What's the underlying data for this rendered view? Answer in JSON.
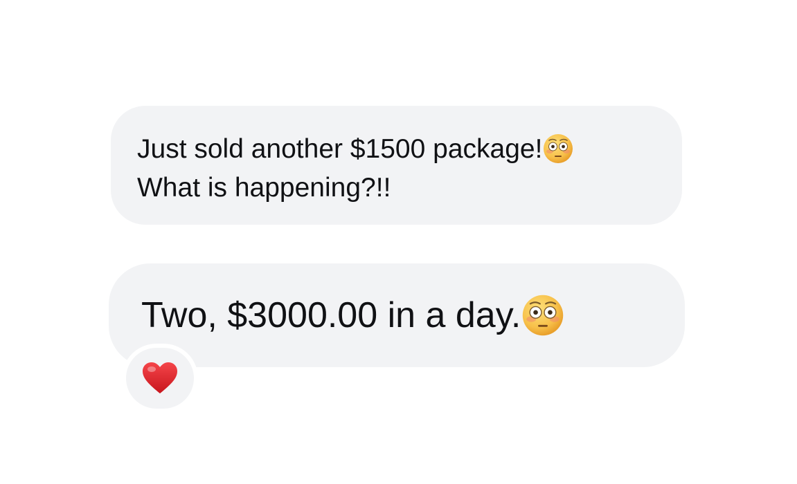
{
  "messages": [
    {
      "lines": [
        "Just sold another $1500 package!",
        "What is happening?!!"
      ],
      "emoji": "flushed-face-icon"
    },
    {
      "text": "Two, $3000.00 in a day.",
      "emoji": "flushed-face-icon"
    }
  ],
  "reaction": {
    "emoji": "red-heart-icon"
  },
  "colors": {
    "bubble_background": "#f2f3f5",
    "text": "#101114",
    "background": "#ffffff",
    "heart": "#e0242b",
    "emoji_face": "#f7c04a"
  }
}
